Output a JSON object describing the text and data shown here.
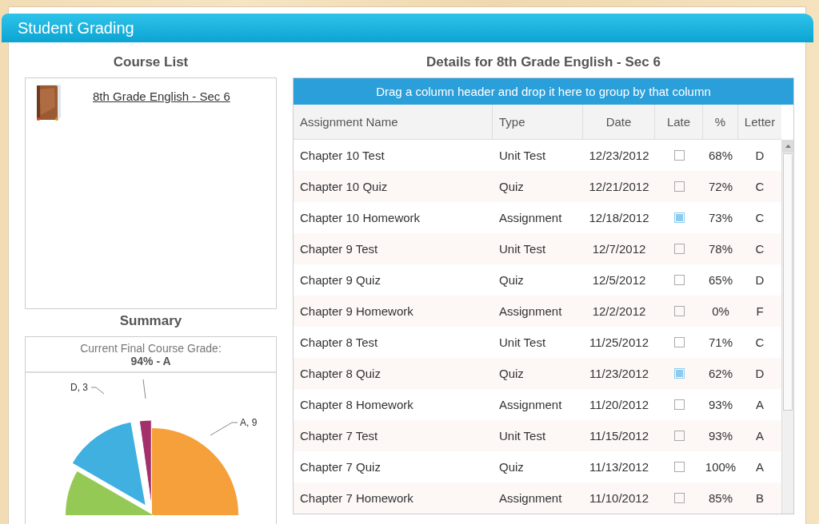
{
  "window": {
    "title": "Student Grading"
  },
  "course_list": {
    "heading": "Course List",
    "items": [
      {
        "label": "8th Grade English - Sec 6",
        "selected": false
      }
    ]
  },
  "summary": {
    "heading": "Summary",
    "grade_caption": "Current Final Course Grade:",
    "grade_value": "94% - A",
    "pie_labels": [
      "A, 9",
      "D, 3"
    ]
  },
  "details": {
    "heading": "Details for 8th Grade English - Sec 6",
    "group_hint": "Drag a column header and drop it here to group by that column",
    "columns": [
      "Assignment Name",
      "Type",
      "Date",
      "Late",
      "%",
      "Letter"
    ],
    "rows": [
      {
        "name": "Chapter 10 Test",
        "type": "Unit Test",
        "date": "12/23/2012",
        "late": false,
        "percent": "68%",
        "letter": "D"
      },
      {
        "name": "Chapter 10 Quiz",
        "type": "Quiz",
        "date": "12/21/2012",
        "late": false,
        "percent": "72%",
        "letter": "C"
      },
      {
        "name": "Chapter 10 Homework",
        "type": "Assignment",
        "date": "12/18/2012",
        "late": true,
        "percent": "73%",
        "letter": "C"
      },
      {
        "name": "Chapter 9 Test",
        "type": "Unit Test",
        "date": "12/7/2012",
        "late": false,
        "percent": "78%",
        "letter": "C"
      },
      {
        "name": "Chapter 9 Quiz",
        "type": "Quiz",
        "date": "12/5/2012",
        "late": false,
        "percent": "65%",
        "letter": "D"
      },
      {
        "name": "Chapter 9 Homework",
        "type": "Assignment",
        "date": "12/2/2012",
        "late": false,
        "percent": "0%",
        "letter": "F"
      },
      {
        "name": "Chapter 8 Test",
        "type": "Unit Test",
        "date": "11/25/2012",
        "late": false,
        "percent": "71%",
        "letter": "C"
      },
      {
        "name": "Chapter 8 Quiz",
        "type": "Quiz",
        "date": "11/23/2012",
        "late": true,
        "percent": "62%",
        "letter": "D"
      },
      {
        "name": "Chapter 8 Homework",
        "type": "Assignment",
        "date": "11/20/2012",
        "late": false,
        "percent": "93%",
        "letter": "A"
      },
      {
        "name": "Chapter 7 Test",
        "type": "Unit Test",
        "date": "11/15/2012",
        "late": false,
        "percent": "93%",
        "letter": "A"
      },
      {
        "name": "Chapter 7 Quiz",
        "type": "Quiz",
        "date": "11/13/2012",
        "late": false,
        "percent": "100%",
        "letter": "A"
      },
      {
        "name": "Chapter 7 Homework",
        "type": "Assignment",
        "date": "11/10/2012",
        "late": false,
        "percent": "85%",
        "letter": "B"
      }
    ]
  }
}
